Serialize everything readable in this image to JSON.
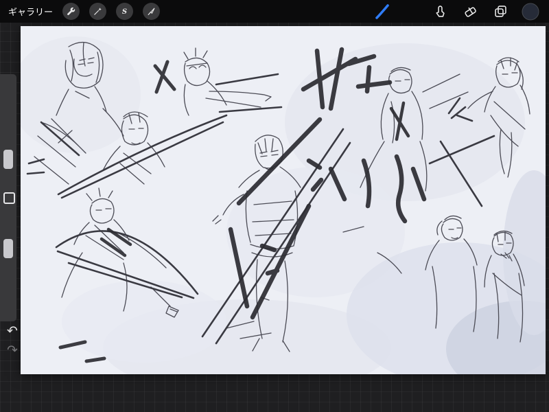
{
  "top_bar": {
    "gallery_label": "ギャラリー",
    "left_tools": [
      {
        "name": "actions",
        "icon": "wrench-icon"
      },
      {
        "name": "adjustments",
        "icon": "magic-wand-icon"
      },
      {
        "name": "selection",
        "icon": "selection-s-icon",
        "glyph": "S"
      },
      {
        "name": "transform",
        "icon": "transform-arrow-icon"
      }
    ],
    "right_tools": [
      {
        "name": "paint",
        "icon": "brush-stroke-icon",
        "active": true
      },
      {
        "name": "smudge",
        "icon": "smudge-finger-icon"
      },
      {
        "name": "erase",
        "icon": "eraser-icon"
      },
      {
        "name": "layers",
        "icon": "layers-icon"
      },
      {
        "name": "color",
        "icon": "color-circle",
        "value": "#262b38"
      }
    ],
    "accent_color": "#2f7cf6"
  },
  "side_toolbar": {
    "sliders": [
      {
        "name": "brush-size"
      },
      {
        "name": "opacity"
      }
    ],
    "undo_glyph": "↶",
    "redo_glyph": "↷"
  },
  "canvas": {
    "background_color": "#edeff5",
    "description": "Rough gray pencil sketches of multiple anime-style characters - archers drawing bows, a central swordsman, and portrait studies - overlaid with bold dark marker strokes on a pale blue-gray washed canvas"
  }
}
